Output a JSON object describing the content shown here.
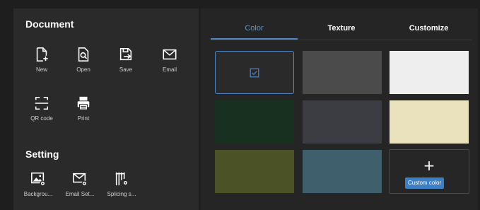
{
  "document_section": {
    "title": "Document",
    "tools": [
      {
        "label": "New",
        "icon": "new-file-icon"
      },
      {
        "label": "Open",
        "icon": "open-file-icon"
      },
      {
        "label": "Save",
        "icon": "save-icon"
      },
      {
        "label": "Email",
        "icon": "email-icon"
      },
      {
        "label": "QR code",
        "icon": "qr-code-icon"
      },
      {
        "label": "Print",
        "icon": "printer-icon"
      }
    ]
  },
  "setting_section": {
    "title": "Setting",
    "tools": [
      {
        "label": "Backgrou...",
        "icon": "background-settings-icon"
      },
      {
        "label": "Email Set...",
        "icon": "email-settings-icon"
      },
      {
        "label": "Splicing s...",
        "icon": "splicing-settings-icon"
      }
    ]
  },
  "tabs": [
    {
      "label": "Color",
      "active": true
    },
    {
      "label": "Texture",
      "active": false
    },
    {
      "label": "Customize",
      "active": false
    }
  ],
  "swatches": [
    {
      "color": "#2a2a2a",
      "selected": true
    },
    {
      "color": "#4b4b4b",
      "selected": false
    },
    {
      "color": "#eeeeee",
      "selected": false
    },
    {
      "color": "#17301f",
      "selected": false
    },
    {
      "color": "#3c3d42",
      "selected": false
    },
    {
      "color": "#e9e2bc",
      "selected": false
    },
    {
      "color": "#4b5326",
      "selected": false
    },
    {
      "color": "#3f5f6d",
      "selected": false
    }
  ],
  "custom_color": {
    "plus": "+",
    "button_label": "Custom color"
  },
  "colors": {
    "accent": "#4f86c6",
    "button": "#3d7fc4",
    "panel": "#2a2a2a",
    "background": "#1e1e1e"
  }
}
